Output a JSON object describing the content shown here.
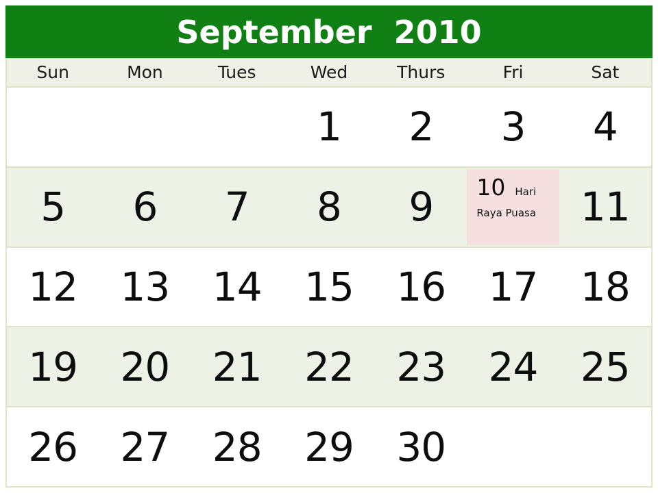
{
  "calendar": {
    "title": "September  2010",
    "month": "September",
    "year": "2010",
    "title_bg_color": "#118014",
    "title_text_color": "#ffffff",
    "grid_border_color": "#dfe2c4",
    "shaded_row_color": "#eef1e5",
    "plain_row_color": "#ffffff",
    "dow_row_color": "#eff1e6",
    "holiday_cell_color": "#f6dfdf",
    "day_headers": [
      "Sun",
      "Mon",
      "Tues",
      "Wed",
      "Thurs",
      "Fri",
      "Sat"
    ],
    "weeks": [
      {
        "shaded": false,
        "days": [
          {
            "num": "",
            "empty": true
          },
          {
            "num": "",
            "empty": true
          },
          {
            "num": "",
            "empty": true
          },
          {
            "num": "1",
            "empty": false
          },
          {
            "num": "2",
            "empty": false
          },
          {
            "num": "3",
            "empty": false
          },
          {
            "num": "4",
            "empty": false
          }
        ]
      },
      {
        "shaded": true,
        "days": [
          {
            "num": "5",
            "empty": false
          },
          {
            "num": "6",
            "empty": false
          },
          {
            "num": "7",
            "empty": false
          },
          {
            "num": "8",
            "empty": false
          },
          {
            "num": "9",
            "empty": false
          },
          {
            "num": "10",
            "empty": false,
            "holiday": true,
            "event_line1": "Hari",
            "event_line2": "Raya Puasa"
          },
          {
            "num": "11",
            "empty": false
          }
        ]
      },
      {
        "shaded": false,
        "days": [
          {
            "num": "12",
            "empty": false
          },
          {
            "num": "13",
            "empty": false
          },
          {
            "num": "14",
            "empty": false
          },
          {
            "num": "15",
            "empty": false
          },
          {
            "num": "16",
            "empty": false
          },
          {
            "num": "17",
            "empty": false
          },
          {
            "num": "18",
            "empty": false
          }
        ]
      },
      {
        "shaded": true,
        "days": [
          {
            "num": "19",
            "empty": false
          },
          {
            "num": "20",
            "empty": false
          },
          {
            "num": "21",
            "empty": false
          },
          {
            "num": "22",
            "empty": false
          },
          {
            "num": "23",
            "empty": false
          },
          {
            "num": "24",
            "empty": false
          },
          {
            "num": "25",
            "empty": false
          }
        ]
      },
      {
        "shaded": false,
        "days": [
          {
            "num": "26",
            "empty": false
          },
          {
            "num": "27",
            "empty": false
          },
          {
            "num": "28",
            "empty": false
          },
          {
            "num": "29",
            "empty": false
          },
          {
            "num": "30",
            "empty": false
          },
          {
            "num": "",
            "empty": true
          },
          {
            "num": "",
            "empty": true
          }
        ]
      }
    ]
  }
}
